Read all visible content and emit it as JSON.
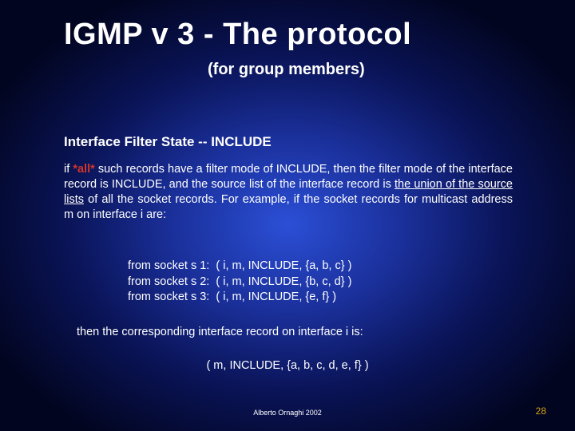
{
  "title": "IGMP v 3 - The protocol",
  "subtitle": "(for group members)",
  "sectionHeader": "Interface Filter State -- INCLUDE",
  "body": {
    "prefix": "if ",
    "allWord": "*all*",
    "part1": " such records have a filter mode of INCLUDE, then the filter mode of the interface record is INCLUDE, and the source list of the interface record is ",
    "underlined": "the union of the source lists",
    "part2": " of all the socket records. For example, if the socket records for multicast address m on interface i are:"
  },
  "records": {
    "r1": "from socket s 1:  ( i, m, INCLUDE, {a, b, c} )",
    "r2": "from socket s 2:  ( i, m, INCLUDE, {b, c, d} )",
    "r3": "from socket s 3:  ( i, m, INCLUDE, {e, f} )"
  },
  "thenText": "then the corresponding interface record on interface i is:",
  "result": "( m, INCLUDE, {a, b, c, d, e, f} )",
  "footer": {
    "author": "Alberto Ornaghi   2002",
    "page": "28"
  }
}
